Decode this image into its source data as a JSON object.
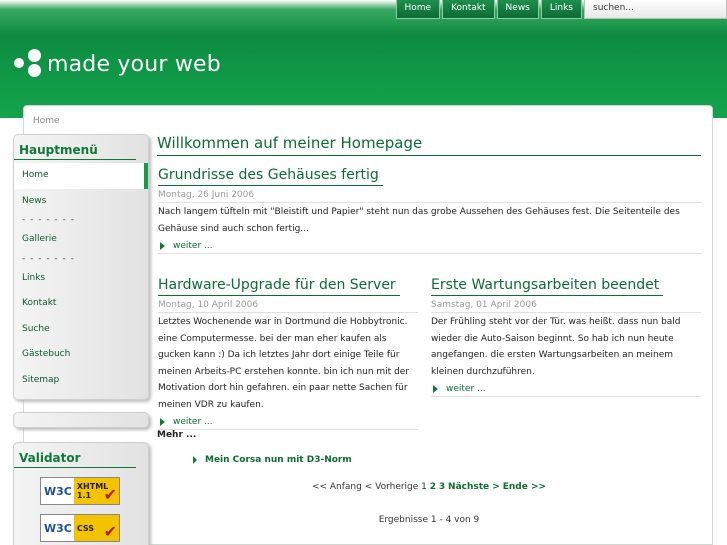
{
  "topnav": {
    "items": [
      "Home",
      "Kontakt",
      "News",
      "Links"
    ],
    "search_placeholder": "suchen..."
  },
  "logo": {
    "text": "made your web"
  },
  "breadcrumb": "Home",
  "sidebar": {
    "menu_title": "Hauptmenü",
    "menu_items": [
      "Home",
      "News",
      "- - - - - - -",
      "Gallerie",
      "- - - - - - -",
      "Links",
      "Kontakt",
      "Suche",
      "Gästebuch",
      "Sitemap"
    ],
    "validator_title": "Validator",
    "badges": [
      {
        "logo": "W3C",
        "line1": "XHTML",
        "line2": "1.1"
      },
      {
        "logo": "W3C",
        "line1": "CSS",
        "line2": ""
      }
    ]
  },
  "main": {
    "title": "Willkommen auf meiner Homepage",
    "articles": [
      {
        "title": "Grundrisse des Gehäuses fertig",
        "date": "Montag, 26 Juni 2006",
        "body": "Nach langem tüfteln mit \"Bleistift und Papier\" steht nun das grobe Aussehen des Gehäuses fest. Die Seitenteile des Gehäuse sind auch schon fertig...",
        "more": "weiter ..."
      },
      {
        "title": "Hardware-Upgrade für den Server",
        "date": "Montag, 10 April 2006",
        "body": "Letztes Wochenende war in Dortmund die Hobbytronic. eine Computermesse. bei der man eher kaufen als gucken kann :) Da ich letztes Jahr dort einige Teile für meinen Arbeits-PC erstehen konnte. bin ich nun mit der Motivation dort hin gefahren. ein paar nette Sachen für meinen VDR zu kaufen.",
        "more": "weiter ..."
      },
      {
        "title": "Erste Wartungsarbeiten beendet",
        "date": "Samstag, 01 April 2006",
        "body": "Der Frühling steht vor der Tür. was heißt. dass nun bald wieder die Auto-Saison beginnt. So hab ich nun heute angefangen. die ersten Wartungsarbeiten an meinem kleinen durchzuführen.",
        "more": "weiter ..."
      }
    ],
    "more_heading": "Mehr ...",
    "more_link": "Mein Corsa nun mit D3-Norm",
    "pager": {
      "prefix": "<< Anfang < Vorherige 1",
      "page2": "2",
      "page3": "3",
      "next": "Nächste >",
      "end": "Ende >>"
    },
    "results": "Ergebnisse 1 - 4 von 9"
  }
}
